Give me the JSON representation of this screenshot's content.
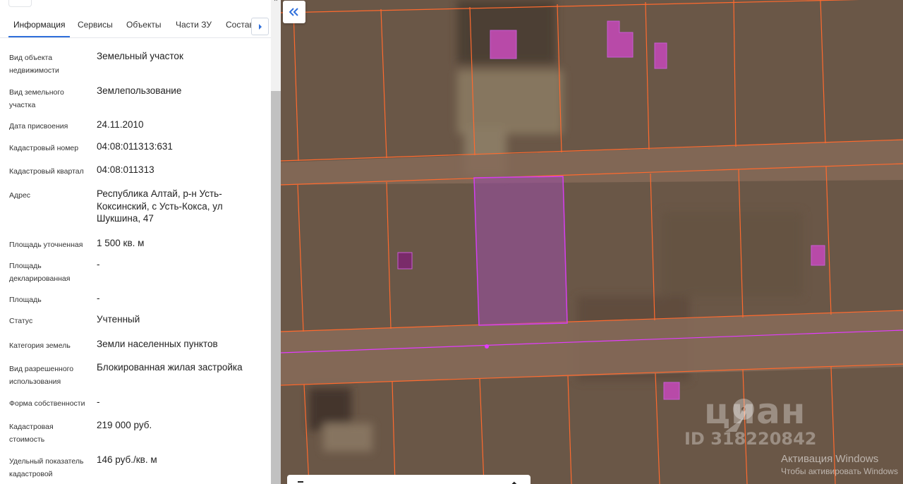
{
  "tabs": [
    {
      "label": "Информация",
      "active": true
    },
    {
      "label": "Сервисы",
      "active": false
    },
    {
      "label": "Объекты",
      "active": false
    },
    {
      "label": "Части ЗУ",
      "active": false
    },
    {
      "label": "Состав",
      "active": false
    }
  ],
  "details": [
    {
      "label": "Вид объекта недвижимости",
      "value": "Земельный участок"
    },
    {
      "label": "Вид земельного участка",
      "value": "Землепользование"
    },
    {
      "label": "Дата присвоения",
      "value": "24.11.2010"
    },
    {
      "label": "Кадастровый номер",
      "value": "04:08:011313:631"
    },
    {
      "label": "Кадастровый квартал",
      "value": "04:08:011313"
    },
    {
      "label": "Адрес",
      "value": "Республика Алтай, р-н Усть-Коксинский, с Усть-Кокса, ул Шукшина, 47"
    },
    {
      "label": "Площадь уточненная",
      "value": "1 500 кв. м"
    },
    {
      "label": "Площадь декларированная",
      "value": "-"
    },
    {
      "label": "Площадь",
      "value": "-"
    },
    {
      "label": "Статус",
      "value": "Учтенный"
    },
    {
      "label": "Категория земель",
      "value": "Земли населенных пунктов"
    },
    {
      "label": "Вид разрешенного использования",
      "value": "Блокированная жилая застройка"
    },
    {
      "label": "Форма собственности",
      "value": "-"
    },
    {
      "label": "Кадастровая стоимость",
      "value": "219 000 руб."
    },
    {
      "label": "Удельный показатель кадастровой",
      "value": "146 руб./кв. м"
    }
  ],
  "watermark": {
    "brand": "циан",
    "id": "ID 318220842"
  },
  "windows_activation": {
    "title": "Активация Windows",
    "subtitle": "Чтобы активировать Windows"
  },
  "icons": {
    "collapse": "double-chevron-left-icon",
    "tab_next": "chevron-right-icon",
    "scroll_up": "chevron-up-icon",
    "logo": "location-pin-icon"
  },
  "colors": {
    "accent": "#2f6fdb",
    "parcel_border": "#ff6a2e",
    "selected_parcel": "#b33cd6",
    "building": "#b84aa8",
    "map_ground": "#6b5848"
  }
}
